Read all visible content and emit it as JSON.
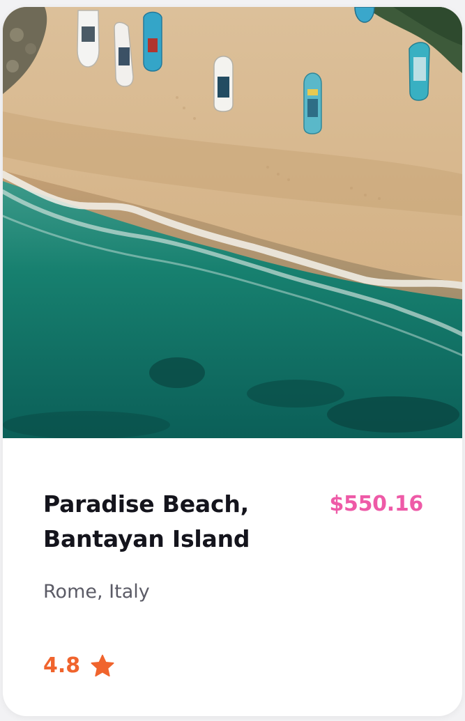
{
  "listing": {
    "title_line1": "Paradise Beach,",
    "title_line2": "Bantayan Island",
    "price": "$550.16",
    "location": "Rome, Italy",
    "rating": "4.8",
    "rating_icon": "star-icon",
    "photo_subject": "aerial-beach-photo"
  },
  "colors": {
    "price": "#ee5aa7",
    "rating": "#f0642d",
    "title": "#14141c",
    "location": "#5b5b66",
    "sand": "#d9b88a",
    "sea": "#0f6f66"
  }
}
